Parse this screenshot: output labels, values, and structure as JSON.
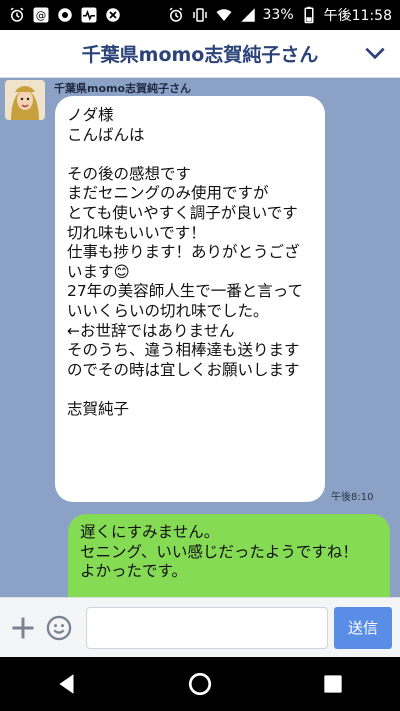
{
  "statusbar": {
    "battery_percent": "33%",
    "time": "午後11:58",
    "icons": [
      "alarm-icon",
      "at-icon",
      "record-icon",
      "pulse-icon",
      "close-circle-icon",
      "alarm-icon",
      "vibrate-icon",
      "wifi-icon",
      "signal-icon",
      "battery-icon"
    ]
  },
  "header": {
    "title": "千葉県momo志賀純子さん"
  },
  "chat": {
    "incoming": {
      "sender": "千葉県momo志賀純子さん",
      "text": "ノダ様\nこんばんは\n\nその後の感想です\nまだセニングのみ使用ですが\nとても使いやすく調子が良いです\n切れ味もいいです！\n仕事も捗ります！ありがとうございます😊\n27年の美容師人生で一番と言っていいくらいの切れ味でした。\n←お世辞ではありません\nそのうち、違う相棒達も送りますのでその時は宜しくお願いします\n\n志賀純子",
      "time": "午後8:10"
    },
    "outgoing": {
      "text": "遅くにすみません。\nセニング、いい感じだったようですね！\nよかったです。"
    }
  },
  "input": {
    "placeholder": "",
    "send_label": "送信"
  },
  "colors": {
    "chat_bg": "#8ba2c6",
    "outgoing_bubble": "#86db55",
    "send_button": "#5a8ee6",
    "header_title": "#2b4378"
  }
}
